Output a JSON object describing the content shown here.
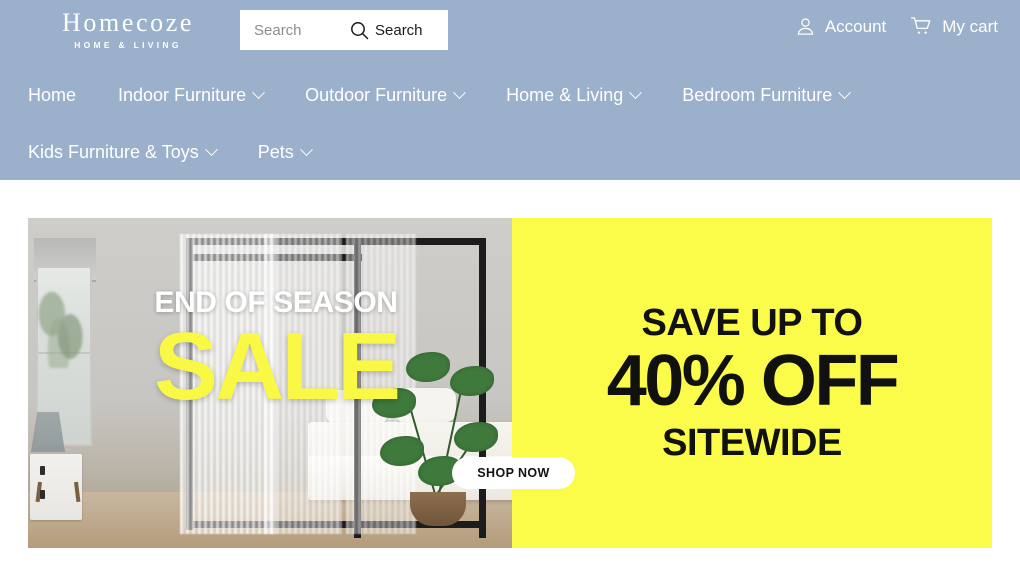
{
  "brand": {
    "name": "Homecoze",
    "tagline": "HOME & LIVING"
  },
  "search": {
    "placeholder": "Search",
    "value": "",
    "button_label": "Search",
    "icon": "search-icon"
  },
  "header_actions": [
    {
      "label": "Account",
      "icon": "user-icon"
    },
    {
      "label": "My cart",
      "icon": "cart-icon"
    }
  ],
  "nav": {
    "items": [
      {
        "label": "Home",
        "has_dropdown": false
      },
      {
        "label": "Indoor Furniture",
        "has_dropdown": true
      },
      {
        "label": "Outdoor Furniture",
        "has_dropdown": true
      },
      {
        "label": "Home & Living",
        "has_dropdown": true
      },
      {
        "label": "Bedroom Furniture",
        "has_dropdown": true
      },
      {
        "label": "Kids Furniture & Toys",
        "has_dropdown": true
      },
      {
        "label": "Pets",
        "has_dropdown": true
      }
    ]
  },
  "hero": {
    "headline_top": "END OF SEASON",
    "headline_big": "SALE",
    "offer_line1": "SAVE UP TO",
    "offer_line2": "40% OFF",
    "offer_line3": "SITEWIDE",
    "cta_label": "SHOP NOW",
    "image_alt": "canopy bed in bedroom with sheer curtains and monstera plant"
  },
  "colors": {
    "header_blue": "#9BB0CB",
    "offer_yellow": "#FBFB49",
    "headline_yellow": "#F9F945",
    "text_dark": "#111111",
    "white": "#FFFFFF"
  }
}
